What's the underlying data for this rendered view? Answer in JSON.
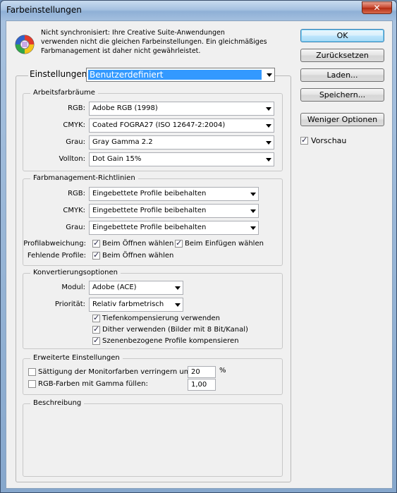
{
  "window": {
    "title": "Farbeinstellungen",
    "close_glyph": "✕"
  },
  "info": {
    "icon": "color-wheel-icon",
    "text_line1": "Nicht synchronisiert: Ihre Creative Suite-Anwendungen",
    "text_line2": "verwenden nicht die gleichen Farbeinstellungen. Ein gleichmäßiges",
    "text_line3": "Farbmanagement ist daher nicht gewährleistet."
  },
  "buttons": {
    "ok": "OK",
    "reset": "Zurücksetzen",
    "load": "Laden...",
    "save": "Speichern...",
    "fewer_options": "Weniger Optionen",
    "preview_label": "Vorschau",
    "preview_checked": true
  },
  "settings": {
    "label": "Einstellungen:",
    "value": "Benutzerdefiniert"
  },
  "workspaces": {
    "title": "Arbeitsfarbräume",
    "rgb_label": "RGB:",
    "rgb_value": "Adobe RGB (1998)",
    "cmyk_label": "CMYK:",
    "cmyk_value": "Coated FOGRA27 (ISO 12647-2:2004)",
    "gray_label": "Grau:",
    "gray_value": "Gray Gamma 2.2",
    "spot_label": "Vollton:",
    "spot_value": "Dot Gain 15%"
  },
  "policies": {
    "title": "Farbmanagement-Richtlinien",
    "rgb_label": "RGB:",
    "rgb_value": "Eingebettete Profile beibehalten",
    "cmyk_label": "CMYK:",
    "cmyk_value": "Eingebettete Profile beibehalten",
    "gray_label": "Grau:",
    "gray_value": "Eingebettete Profile beibehalten",
    "mismatch_label": "Profilabweichung:",
    "mismatch_open": "Beim Öffnen wählen",
    "mismatch_open_checked": true,
    "mismatch_paste": "Beim Einfügen wählen",
    "mismatch_paste_checked": true,
    "missing_label": "Fehlende Profile:",
    "missing_open": "Beim Öffnen wählen",
    "missing_open_checked": true
  },
  "conversion": {
    "title": "Konvertierungsoptionen",
    "engine_label": "Modul:",
    "engine_value": "Adobe (ACE)",
    "intent_label": "Priorität:",
    "intent_value": "Relativ farbmetrisch",
    "bpc": "Tiefenkompensierung verwenden",
    "bpc_checked": true,
    "dither": "Dither verwenden (Bilder mit 8 Bit/Kanal)",
    "dither_checked": true,
    "scene": "Szenenbezogene Profile kompensieren",
    "scene_checked": true
  },
  "advanced": {
    "title": "Erweiterte Einstellungen",
    "desaturate": "Sättigung der Monitorfarben verringern um:",
    "desaturate_checked": false,
    "desaturate_value": "20",
    "desaturate_unit": "%",
    "blend": "RGB-Farben mit Gamma füllen:",
    "blend_checked": false,
    "blend_value": "1,00"
  },
  "description": {
    "title": "Beschreibung"
  }
}
